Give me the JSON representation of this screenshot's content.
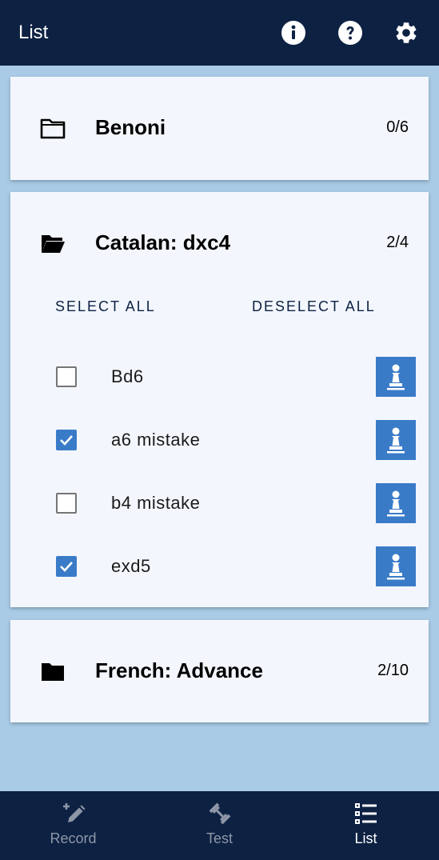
{
  "appbar": {
    "title": "List",
    "icons": [
      "info-icon",
      "help-icon",
      "settings-icon"
    ]
  },
  "openings": [
    {
      "name": "Benoni",
      "count": "0/6",
      "expanded": false
    },
    {
      "name": "Catalan: dxc4",
      "count": "2/4",
      "expanded": true,
      "select_all_label": "SELECT ALL",
      "deselect_all_label": "DESELECT ALL",
      "lines": [
        {
          "label": "Bd6",
          "checked": false
        },
        {
          "label": "a6 mistake",
          "checked": true
        },
        {
          "label": "b4 mistake",
          "checked": false
        },
        {
          "label": "exd5",
          "checked": true
        }
      ]
    },
    {
      "name": "French: Advance",
      "count": "2/10",
      "expanded": false
    }
  ],
  "tabs": [
    {
      "label": "Record",
      "icon": "pencil-plus-icon",
      "active": false
    },
    {
      "label": "Test",
      "icon": "dumbbell-icon",
      "active": false
    },
    {
      "label": "List",
      "icon": "list-icon",
      "active": true
    }
  ],
  "colors": {
    "appbar": "#0d2143",
    "background": "#a9cbe6",
    "card": "#f3f7fd",
    "accent": "#3a7bc8"
  }
}
